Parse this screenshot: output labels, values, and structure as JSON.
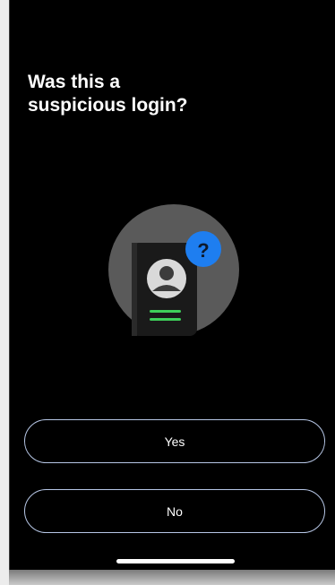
{
  "prompt": {
    "title_line1": "Was this a",
    "title_line2": "suspicious login?"
  },
  "illustration": {
    "badge_symbol": "?",
    "icons": [
      "phone-icon",
      "avatar-icon",
      "question-badge-icon"
    ]
  },
  "actions": {
    "yes_label": "Yes",
    "no_label": "No"
  },
  "colors": {
    "background": "#000000",
    "button_border": "#b7c7e6",
    "badge_blue": "#1e7ef0",
    "accent_green": "#3ecf5a"
  }
}
